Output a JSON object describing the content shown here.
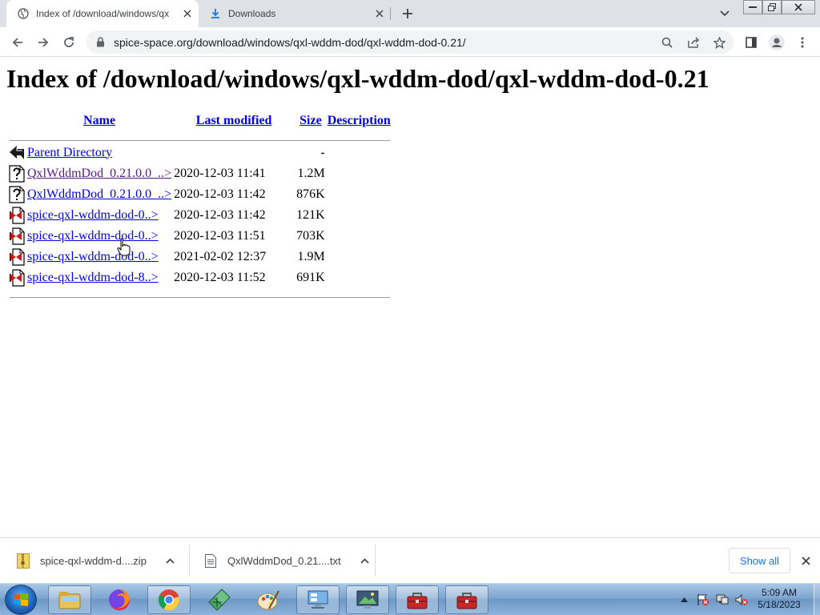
{
  "browser": {
    "tabs": [
      {
        "title": "Index of /download/windows/qx",
        "active": true,
        "icon": "globe-icon"
      },
      {
        "title": "Downloads",
        "active": false,
        "icon": "download-icon"
      }
    ],
    "url": "spice-space.org/download/windows/qxl-wddm-dod/qxl-wddm-dod-0.21/"
  },
  "page": {
    "heading": "Index of /download/windows/qxl-wddm-dod/qxl-wddm-dod-0.21",
    "columns": {
      "name": "Name",
      "last_modified": "Last modified",
      "size": "Size",
      "description": "Description"
    },
    "parent": {
      "name": "Parent Directory",
      "modified": "",
      "size": "-"
    },
    "rows": [
      {
        "name": "QxlWddmDod_0.21.0.0_..>",
        "modified": "2020-12-03 11:41",
        "size": "1.2M",
        "icon": "unknown-file-icon",
        "visited": true
      },
      {
        "name": "QxlWddmDod_0.21.0.0_..>",
        "modified": "2020-12-03 11:42",
        "size": "876K",
        "icon": "unknown-file-icon",
        "visited": false
      },
      {
        "name": "spice-qxl-wddm-dod-0..>",
        "modified": "2020-12-03 11:42",
        "size": "121K",
        "icon": "compressed-file-icon",
        "visited": false
      },
      {
        "name": "spice-qxl-wddm-dod-0..>",
        "modified": "2020-12-03 11:51",
        "size": "703K",
        "icon": "compressed-file-icon",
        "visited": false
      },
      {
        "name": "spice-qxl-wddm-dod-0..>",
        "modified": "2021-02-02 12:37",
        "size": "1.9M",
        "icon": "compressed-file-icon",
        "visited": false
      },
      {
        "name": "spice-qxl-wddm-dod-8..>",
        "modified": "2020-12-03 11:52",
        "size": "691K",
        "icon": "compressed-file-icon",
        "visited": false
      }
    ]
  },
  "downloads": {
    "items": [
      {
        "name": "spice-qxl-wddm-d....zip",
        "icon": "zip-file-icon"
      },
      {
        "name": "QxlWddmDod_0.21....txt",
        "icon": "text-file-icon"
      }
    ],
    "show_all": "Show all"
  },
  "taskbar": {
    "apps": [
      "file-explorer-icon",
      "firefox-icon",
      "chrome-icon",
      "network-icon",
      "paint-icon",
      "remote-desktop-icon",
      "display-icon",
      "toolbox-icon",
      "toolbox-icon"
    ],
    "time": "5:09 AM",
    "date": "5/18/2023"
  },
  "colors": {
    "link": "#0000ee",
    "visited": "#551a8b",
    "accent": "#1a73e8"
  }
}
